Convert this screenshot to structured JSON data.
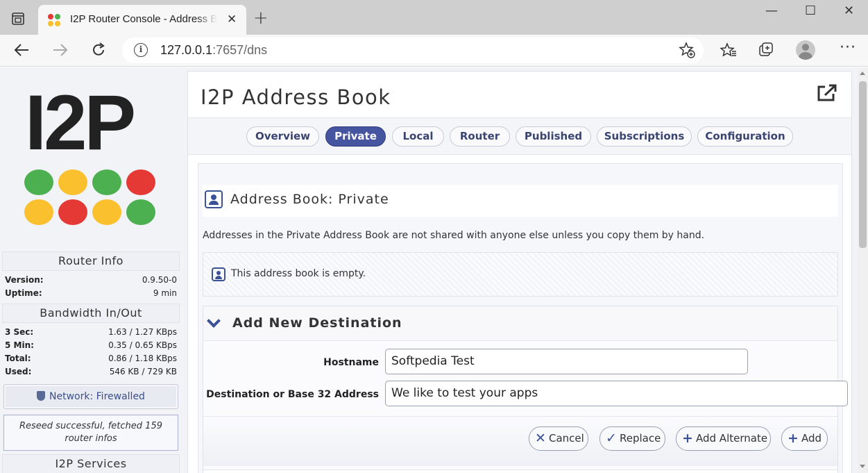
{
  "browser": {
    "tab_title": "I2P Router Console - Address Book",
    "tab_close": "✕",
    "new_tab": "+",
    "window_controls": {
      "minimize": "—",
      "maximize": "☐",
      "close": "✕"
    },
    "address": {
      "host": "127.0.0.1",
      "rest": ":7657/dns"
    },
    "icons": [
      "back-icon",
      "forward-icon",
      "reload-icon",
      "site-info-icon",
      "add-favorite-icon",
      "favorites-icon",
      "collections-icon",
      "profile-icon",
      "more-icon"
    ]
  },
  "sidebar": {
    "logo": "I2P",
    "logo_dot_colors": [
      "#4caf50",
      "#fbc02d",
      "#4caf50",
      "#e53935",
      "#fbc02d",
      "#e53935",
      "#fbc02d",
      "#4caf50"
    ],
    "router_info": {
      "title": "Router Info",
      "rows": [
        {
          "label": "Version:",
          "value": "0.9.50-0"
        },
        {
          "label": "Uptime:",
          "value": "9 min"
        }
      ]
    },
    "bandwidth": {
      "title": "Bandwidth In/Out",
      "rows": [
        {
          "label": "3 Sec:",
          "value": "1.63 / 1.27 KBps"
        },
        {
          "label": "5 Min:",
          "value": "0.35 / 0.65 KBps"
        },
        {
          "label": "Total:",
          "value": "0.86 / 1.18 KBps"
        },
        {
          "label": "Used:",
          "value": "546 KB / 729 KB"
        }
      ]
    },
    "network_status": "Network: Firewalled",
    "reseed_message": "Reseed successful, fetched 159 router infos",
    "services_title": "I2P Services"
  },
  "main": {
    "title": "I2P Address Book",
    "tabs": [
      {
        "label": "Overview",
        "active": false
      },
      {
        "label": "Private",
        "active": true
      },
      {
        "label": "Local",
        "active": false
      },
      {
        "label": "Router",
        "active": false
      },
      {
        "label": "Published",
        "active": false
      },
      {
        "label": "Subscriptions",
        "active": false
      },
      {
        "label": "Configuration",
        "active": false
      }
    ],
    "section_title": "Address Book: Private",
    "description": "Addresses in the Private Address Book are not shared with anyone else unless you copy them by hand.",
    "empty_message": "This address book is empty.",
    "add_new": {
      "title": "Add New Destination",
      "hostname_label": "Hostname",
      "hostname_value": "Softpedia Test",
      "destination_label": "Destination or Base 32 Address",
      "destination_value": "We like to test your apps",
      "buttons": {
        "cancel": "Cancel",
        "replace": "Replace",
        "add_alternate": "Add Alternate",
        "add": "Add"
      }
    }
  },
  "colors": {
    "accent": "#4555a0",
    "icon_blue": "#3b5196",
    "page_bg": "#f2f3f7"
  }
}
